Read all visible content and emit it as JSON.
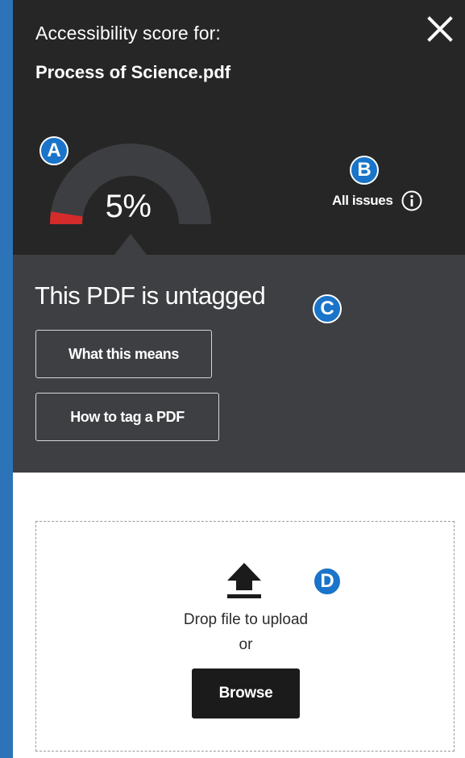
{
  "header": {
    "score_label": "Accessibility score for:",
    "file_name": "Process of Science.pdf",
    "close_icon": "close-icon"
  },
  "gauge": {
    "value_text": "5%",
    "value_fraction": 0.05,
    "fill_color": "#d62b2b",
    "track_color": "#3d3e41"
  },
  "markers": {
    "a": "A",
    "b": "B",
    "c": "C",
    "d": "D",
    "color": "#1a74c9"
  },
  "all_issues": {
    "label": "All issues",
    "icon": "info-icon"
  },
  "status": {
    "title": "This PDF is untagged",
    "buttons": {
      "what_this_means": "What this means",
      "how_to_tag": "How to tag a PDF"
    }
  },
  "upload": {
    "icon": "upload-icon",
    "drop_text": "Drop file to upload",
    "or_text": "or",
    "browse_label": "Browse"
  }
}
